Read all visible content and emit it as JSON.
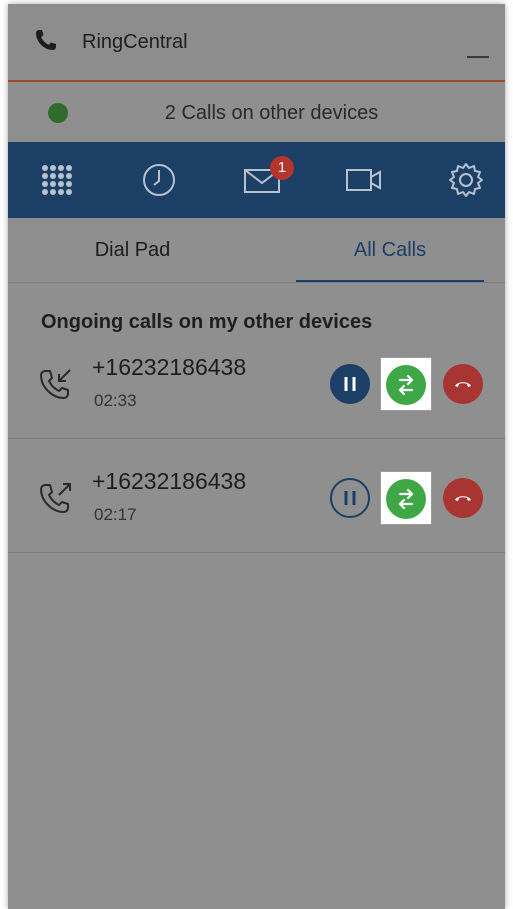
{
  "app": {
    "title": "RingCentral"
  },
  "status": {
    "text": "2 Calls on other devices",
    "indicator_color": "#2f6b2a"
  },
  "nav": {
    "items": [
      {
        "icon": "dialpad-grid-icon"
      },
      {
        "icon": "clock-icon"
      },
      {
        "icon": "envelope-icon",
        "badge": "1"
      },
      {
        "icon": "video-camera-icon"
      },
      {
        "icon": "gear-icon"
      }
    ],
    "accent_color": "#1c3f66"
  },
  "tabs": [
    {
      "label": "Dial Pad",
      "active": false
    },
    {
      "label": "All Calls",
      "active": true
    }
  ],
  "section": {
    "heading": "Ongoing calls on my other devices"
  },
  "calls": [
    {
      "direction": "incoming",
      "number": "+16232186438",
      "duration": "02:33",
      "on_hold": true
    },
    {
      "direction": "outgoing",
      "number": "+16232186438",
      "duration": "02:17",
      "on_hold": false
    }
  ]
}
